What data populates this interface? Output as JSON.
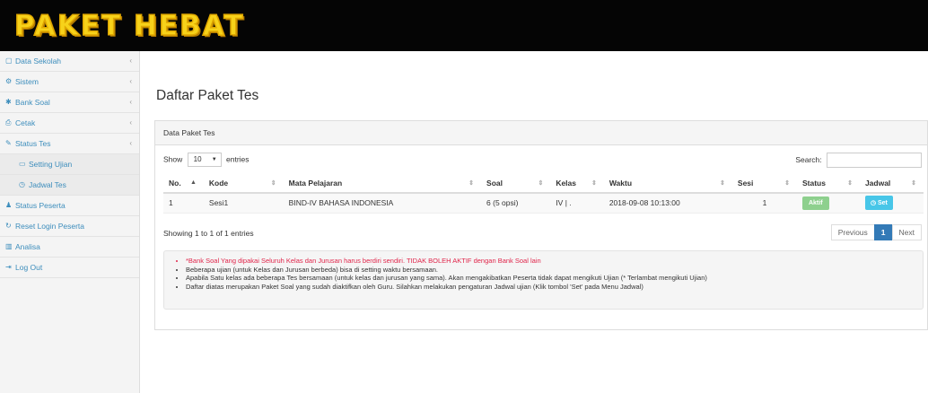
{
  "app": {
    "logo": "PAKET HEBAT"
  },
  "sidebar": {
    "items": [
      {
        "label": "Data Sekolah",
        "icon": "building-icon",
        "glyph": "▢",
        "chev": "‹"
      },
      {
        "label": "Sistem",
        "icon": "cogs-icon",
        "glyph": "⚙",
        "chev": "‹"
      },
      {
        "label": "Bank Soal",
        "icon": "gear-icon",
        "glyph": "✱",
        "chev": "‹"
      },
      {
        "label": "Cetak",
        "icon": "print-icon",
        "glyph": "⎙",
        "chev": "‹"
      },
      {
        "label": "Status Tes",
        "icon": "edit-icon",
        "glyph": "✎",
        "chev": "‹"
      },
      {
        "label": "Setting Ujian",
        "icon": "folder-icon",
        "glyph": "▭"
      },
      {
        "label": "Jadwal Tes",
        "icon": "clock-icon",
        "glyph": "◷"
      },
      {
        "label": "Status Peserta",
        "icon": "user-icon",
        "glyph": "♟"
      },
      {
        "label": "Reset Login Peserta",
        "icon": "refresh-icon",
        "glyph": "↻"
      },
      {
        "label": "Analisa",
        "icon": "bar-chart-icon",
        "glyph": "▥"
      },
      {
        "label": "Log Out",
        "icon": "sign-out-icon",
        "glyph": "⇥"
      }
    ]
  },
  "main": {
    "title": "Daftar Paket Tes",
    "panel_title": "Data Paket Tes",
    "show_label": "Show",
    "entries_value": "10",
    "entries_label": "entries",
    "search_label": "Search:",
    "search_value": "",
    "columns": [
      "No.",
      "Kode",
      "Mata Pelajaran",
      "Soal",
      "Kelas",
      "Waktu",
      "Sesi",
      "Status",
      "Jadwal"
    ],
    "rows": [
      {
        "no": "1",
        "kode": "Sesi1",
        "mapel": "BIND-IV BAHASA INDONESIA",
        "soal": "6 (5 opsi)",
        "kelas": "IV | .",
        "waktu": "2018-09-08 10:13:00",
        "sesi": "1",
        "status": "Aktif",
        "jadwal": "Set"
      }
    ],
    "info": "Showing 1 to 1 of 1 entries",
    "pager": {
      "prev": "Previous",
      "current": "1",
      "next": "Next"
    },
    "notes": [
      "*Bank Soal Yang dipakai Seluruh Kelas dan Jurusan harus berdiri sendiri. TIDAK BOLEH AKTIF dengan Bank Soal lain",
      "Beberapa ujian (untuk Kelas dan Jurusan berbeda) bisa di setting waktu bersamaan.",
      "Apabila Satu kelas ada beberapa Tes bersamaan (untuk kelas dan jurusan yang sama). Akan mengakibatkan Peserta tidak dapat mengikuti Ujian (* Terlambat mengikuti Ujian)",
      "Daftar diatas merupakan Paket Soal yang sudah diaktifkan oleh Guru. Silahkan melakukan pengaturan Jadwal ujian (Klik tombol 'Set' pada Menu Jadwal)"
    ]
  },
  "colors": {
    "logo": "#f7d21a",
    "link": "#3c8dbc",
    "aktif": "#8ed08e",
    "set": "#48c6e8",
    "warning": "#e0254a",
    "pager_active": "#337ab7"
  }
}
